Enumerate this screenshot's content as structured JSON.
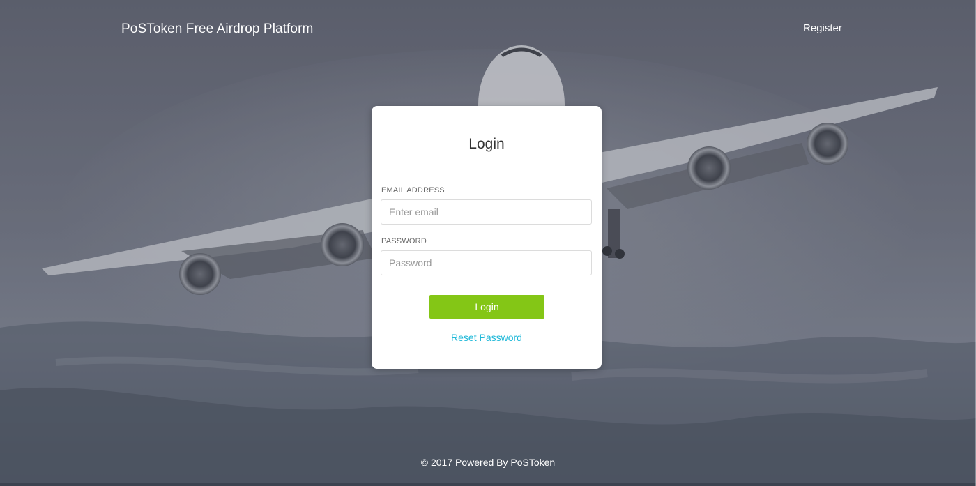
{
  "header": {
    "brand": "PoSToken Free Airdrop Platform",
    "register_label": "Register"
  },
  "login_card": {
    "title": "Login",
    "email": {
      "label": "EMAIL ADDRESS",
      "placeholder": "Enter email",
      "value": ""
    },
    "password": {
      "label": "PASSWORD",
      "placeholder": "Password",
      "value": ""
    },
    "submit_label": "Login",
    "reset_label": "Reset Password"
  },
  "footer": {
    "text": "© 2017 Powered By PoSToken"
  },
  "colors": {
    "accent_button": "#84c616",
    "link": "#1fb8d8",
    "card_background": "#ffffff"
  },
  "background": {
    "description_icon": "airplane-background-image"
  }
}
